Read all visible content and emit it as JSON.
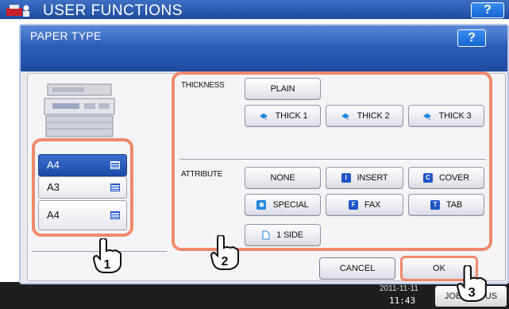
{
  "app": {
    "title": "USER FUNCTIONS",
    "help_label": "?",
    "clock_date": "2011-11-11",
    "clock_time": "11:43",
    "job_status_label": "JOB STATUS"
  },
  "dialog": {
    "title": "PAPER TYPE",
    "help_label": "?"
  },
  "drawers": [
    {
      "label": "A4",
      "selected": true
    },
    {
      "label": "A3",
      "selected": false
    },
    {
      "label": "A4",
      "selected": false
    }
  ],
  "thickness": {
    "label": "THICKNESS",
    "options": [
      {
        "label": "PLAIN",
        "icon": "none"
      },
      {
        "label": "THICK 1",
        "icon": "paper-1-icon"
      },
      {
        "label": "THICK 2",
        "icon": "paper-2-icon"
      },
      {
        "label": "THICK 3",
        "icon": "paper-3-icon"
      }
    ]
  },
  "attribute": {
    "label": "ATTRIBUTE",
    "options": [
      {
        "label": "NONE",
        "icon": "none"
      },
      {
        "label": "INSERT",
        "icon": "I"
      },
      {
        "label": "COVER",
        "icon": "C"
      },
      {
        "label": "SPECIAL",
        "icon": "star"
      },
      {
        "label": "FAX",
        "icon": "F"
      },
      {
        "label": "TAB",
        "icon": "T"
      },
      {
        "label": "1 SIDE",
        "icon": "page"
      }
    ]
  },
  "footer": {
    "cancel_label": "CANCEL",
    "ok_label": "OK"
  },
  "annotations": [
    "1",
    "2",
    "3"
  ],
  "colors": {
    "highlight": "#ef8a6a",
    "title_bar": "#2a5bb4",
    "selected_drawer": "#1b4ba8"
  }
}
